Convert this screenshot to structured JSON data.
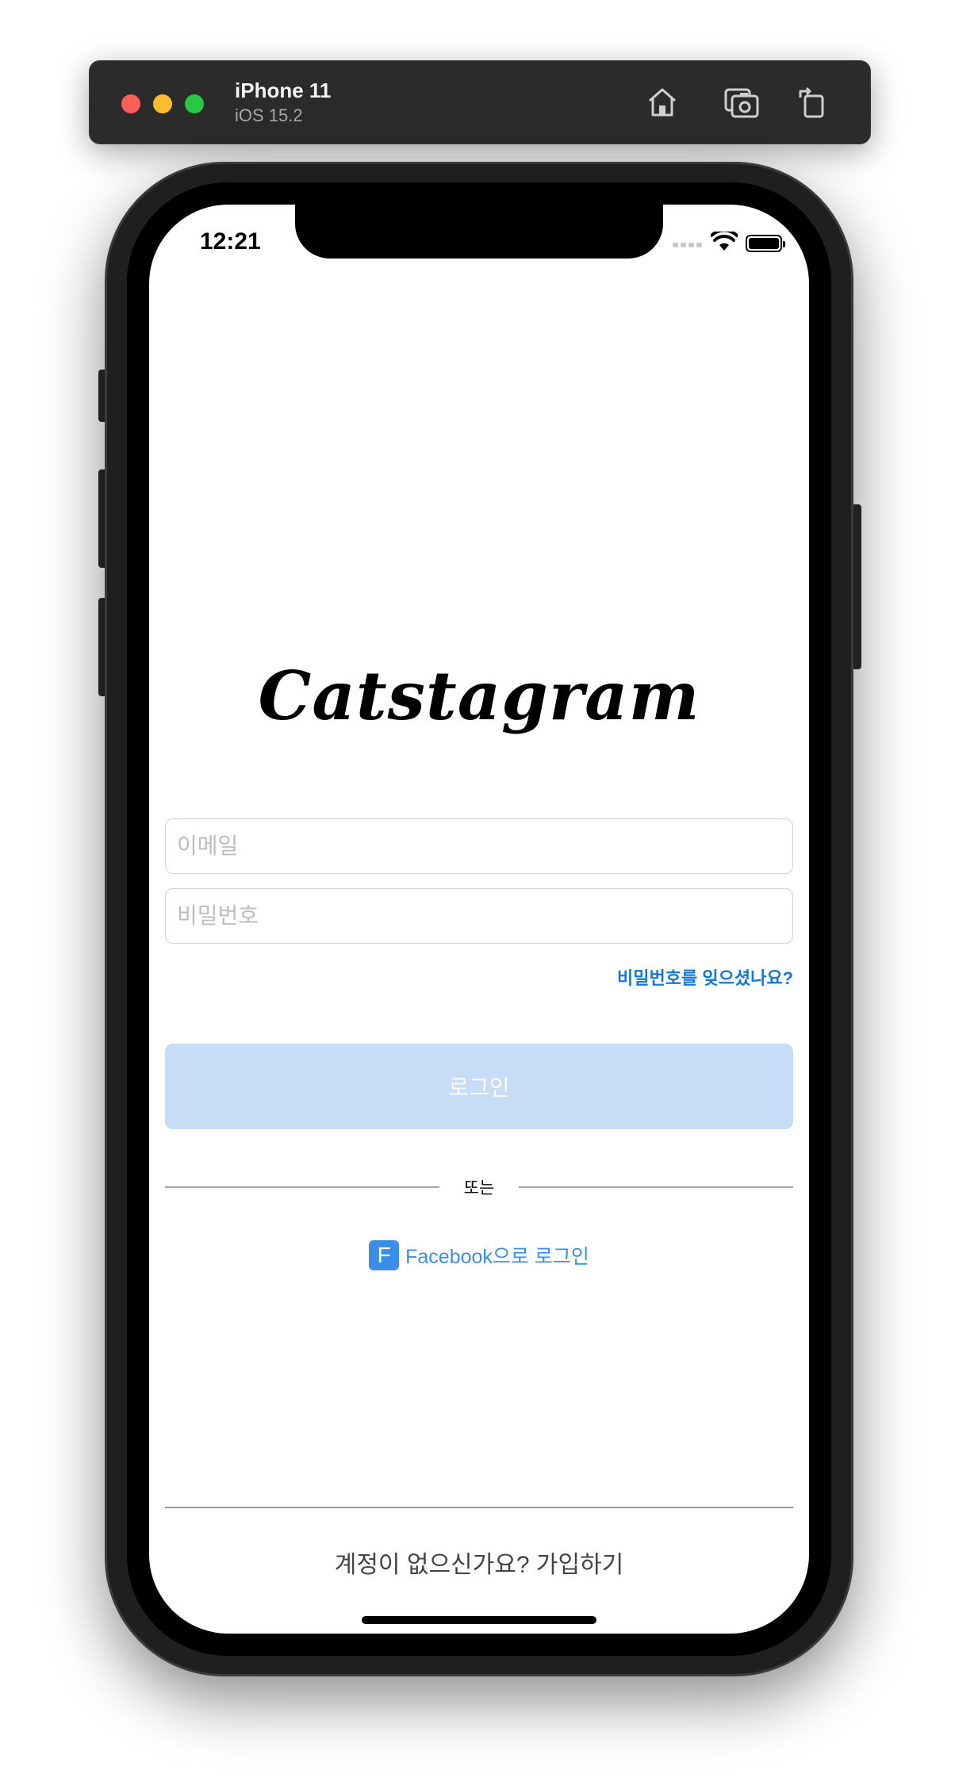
{
  "simulator": {
    "device_name": "iPhone 11",
    "os_version": "iOS 15.2",
    "toolbar_icons": [
      "home-icon",
      "screenshot-icon",
      "rotate-icon"
    ]
  },
  "status_bar": {
    "time": "12:21",
    "icons": [
      "cellular-signal-icon",
      "wifi-icon",
      "battery-icon"
    ]
  },
  "app": {
    "logo_text": "Catstagram",
    "email": {
      "placeholder": "이메일",
      "value": ""
    },
    "password": {
      "placeholder": "비밀번호",
      "value": ""
    },
    "forgot_password_label": "비밀번호를 잊으셨나요?",
    "login_label": "로그인",
    "or_label": "또는",
    "facebook_icon_letter": "F",
    "facebook_login_label": "Facebook으로 로그인",
    "signup_label": "계정이 없으신가요? 가입하기"
  },
  "colors": {
    "accent_blue": "#1877d6",
    "login_button_disabled": "#c6dcf7",
    "facebook_blue": "#3b8ee8"
  }
}
